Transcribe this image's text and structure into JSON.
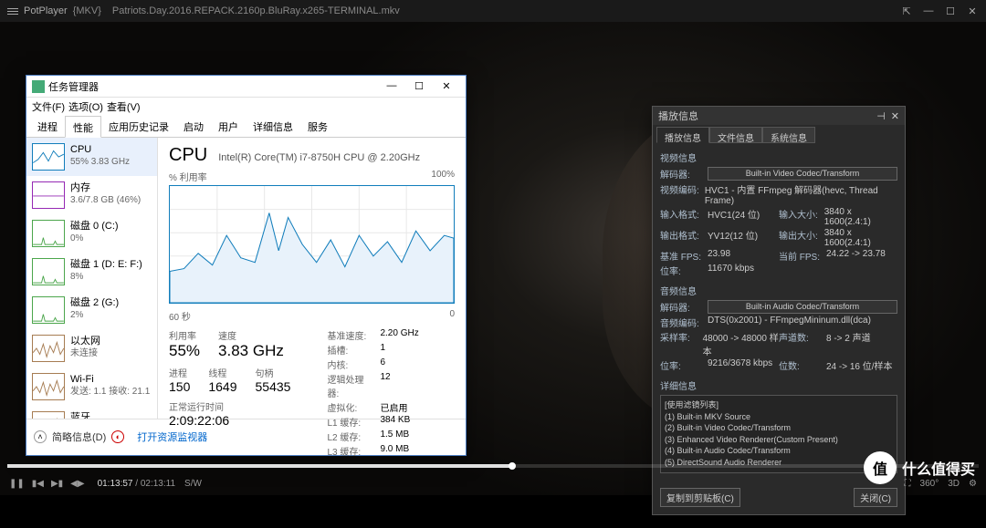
{
  "potplayer": {
    "app": "PotPlayer",
    "format": "{MKV}",
    "filename": "Patriots.Day.2016.REPACK.2160p.BluRay.x265-TERMINAL.mkv",
    "winctrls": {
      "pin": "⇱",
      "min": "—",
      "max": "☐",
      "close": "✕"
    },
    "progress_pct": 52,
    "controls": {
      "pause": "❚❚",
      "prev": "▮◀",
      "next": "▶▮",
      "stop": "◀▶",
      "cur_time": "01:13:57",
      "total_time": "02:13:11",
      "sw": "S/W"
    },
    "right_ctrls": [
      "⛶",
      "360°",
      "3D",
      "⚙"
    ]
  },
  "watermark": {
    "icon": "值",
    "text": "什么值得买"
  },
  "taskmgr": {
    "title": "任务管理器",
    "menu": [
      "文件(F)",
      "选项(O)",
      "查看(V)"
    ],
    "tabs": [
      "进程",
      "性能",
      "应用历史记录",
      "启动",
      "用户",
      "详细信息",
      "服务"
    ],
    "active_tab": 1,
    "sidebar": [
      {
        "name": "CPU",
        "val": "55% 3.83 GHz",
        "kind": "cpu"
      },
      {
        "name": "内存",
        "val": "3.6/7.8 GB (46%)",
        "kind": "mem"
      },
      {
        "name": "磁盘 0 (C:)",
        "val": "0%",
        "kind": "disk"
      },
      {
        "name": "磁盘 1 (D: E: F:)",
        "val": "8%",
        "kind": "disk"
      },
      {
        "name": "磁盘 2 (G:)",
        "val": "2%",
        "kind": "disk"
      },
      {
        "name": "以太网",
        "val": "未连接",
        "kind": "eth"
      },
      {
        "name": "Wi-Fi",
        "val": "发送: 1.1 接收: 21.1",
        "kind": "eth"
      },
      {
        "name": "蓝牙",
        "val": "",
        "kind": "eth"
      }
    ],
    "main": {
      "big": "CPU",
      "model": "Intel(R) Core(TM) i7-8750H CPU @ 2.20GHz",
      "util_label": "% 利用率",
      "util_max": "100%",
      "x_left": "60 秒",
      "x_right": "0",
      "stats_row1": [
        {
          "lbl": "利用率",
          "v": "55%"
        },
        {
          "lbl": "速度",
          "v": "3.83 GHz"
        }
      ],
      "stats_row2": [
        {
          "lbl": "进程",
          "v": "150"
        },
        {
          "lbl": "线程",
          "v": "1649"
        },
        {
          "lbl": "句柄",
          "v": "55435"
        }
      ],
      "uptime_lbl": "正常运行时间",
      "uptime": "2:09:22:06",
      "kv": [
        {
          "k": "基准速度:",
          "v": "2.20 GHz"
        },
        {
          "k": "插槽:",
          "v": "1"
        },
        {
          "k": "内核:",
          "v": "6"
        },
        {
          "k": "逻辑处理器:",
          "v": "12"
        },
        {
          "k": "虚拟化:",
          "v": "已启用"
        },
        {
          "k": "L1 缓存:",
          "v": "384 KB"
        },
        {
          "k": "L2 缓存:",
          "v": "1.5 MB"
        },
        {
          "k": "L3 缓存:",
          "v": "9.0 MB"
        }
      ]
    },
    "footer": {
      "less": "简略信息(D)",
      "link": "打开资源监视器"
    }
  },
  "playinfo": {
    "title": "播放信息",
    "tabs": [
      "播放信息",
      "文件信息",
      "系统信息"
    ],
    "video": {
      "stitle": "视频信息",
      "decoder_lbl": "解码器:",
      "decoder": "Built-in Video Codec/Transform",
      "rows": [
        {
          "k": "视频编码:",
          "v": "HVC1 - 内置 FFmpeg 解码器(hevc, Thread Frame)"
        },
        {
          "k1": "输入格式:",
          "v1": "HVC1(24 位)",
          "k2": "输入大小:",
          "v2": "3840 x 1600(2.4:1)"
        },
        {
          "k1": "输出格式:",
          "v1": "YV12(12 位)",
          "k2": "输出大小:",
          "v2": "3840 x 1600(2.4:1)"
        },
        {
          "k1": "基准 FPS:",
          "v1": "23.98",
          "k2": "当前 FPS:",
          "v2": "24.22 -> 23.78"
        },
        {
          "k1": "位率:",
          "v1": "11670 kbps"
        }
      ]
    },
    "audio": {
      "stitle": "音频信息",
      "decoder_lbl": "解码器:",
      "decoder": "Built-in Audio Codec/Transform",
      "rows": [
        {
          "k": "音频编码:",
          "v": "DTS(0x2001) - FFmpegMininum.dll(dca)"
        },
        {
          "k1": "采样率:",
          "v1": "48000 -> 48000 样本",
          "k2": "声道数:",
          "v2": "8 -> 2 声道"
        },
        {
          "k1": "位率:",
          "v1": "9216/3678 kbps",
          "k2": "位数:",
          "v2": "24 -> 16 位/样本"
        }
      ]
    },
    "details": {
      "stitle": "详细信息",
      "lines": [
        "[使用滤镜列表]",
        "(1) Built-in MKV Source",
        "(2) Built-in Video Codec/Transform",
        "(3) Enhanced Video Renderer(Custom Present)",
        "(4) Built-in Audio Codec/Transform",
        "(5) DirectSound Audio Renderer"
      ]
    },
    "footer": {
      "copy": "复制到剪贴板(C)",
      "close": "关闭(C)"
    }
  }
}
